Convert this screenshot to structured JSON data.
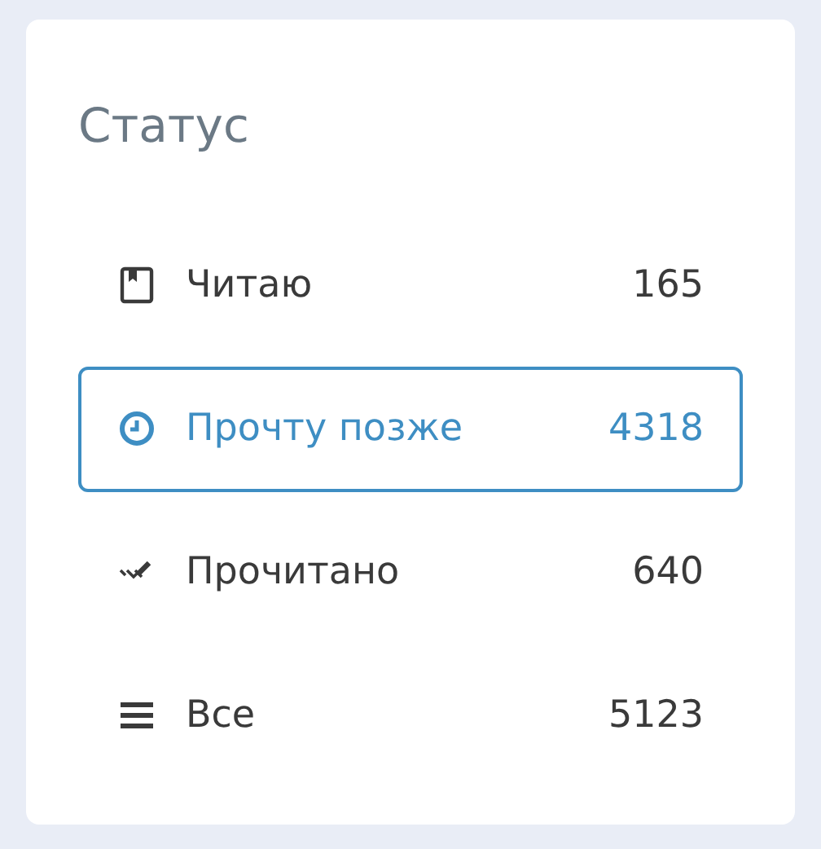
{
  "title": "Статус",
  "items": [
    {
      "kind": "book",
      "label": "Читаю",
      "count": "165",
      "selected": false
    },
    {
      "kind": "clock",
      "label": "Прочту позже",
      "count": "4318",
      "selected": true
    },
    {
      "kind": "check",
      "label": "Прочитано",
      "count": "640",
      "selected": false
    },
    {
      "kind": "list",
      "label": "Все",
      "count": "5123",
      "selected": false
    }
  ]
}
